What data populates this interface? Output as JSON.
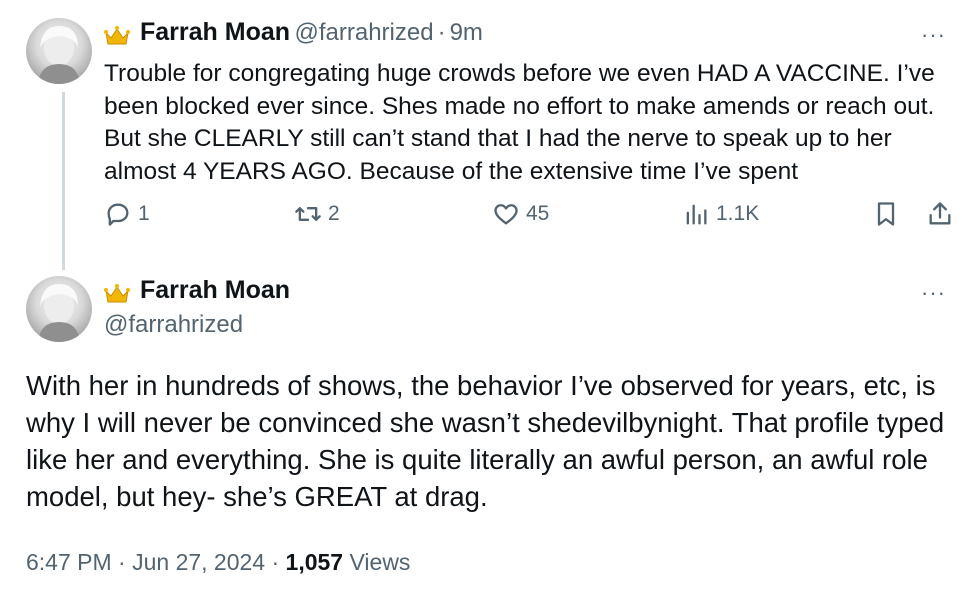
{
  "tweet1": {
    "display_name": "Farrah Moan",
    "handle": "@farrahrized",
    "separator": "·",
    "time": "9m",
    "more": "···",
    "text": "Trouble for congregating huge crowds before we even HAD A VACCINE. I’ve been blocked ever since. Shes made no effort to make amends or reach out. But she CLEARLY still can’t stand that I had the nerve to speak up to her almost 4 YEARS AGO. Because of the extensive time I’ve spent",
    "actions": {
      "replies": "1",
      "reposts": "2",
      "likes": "45",
      "views": "1.1K"
    }
  },
  "tweet2": {
    "display_name": "Farrah Moan",
    "handle": "@farrahrized",
    "more": "···",
    "text": "With her in hundreds of shows, the behavior I’ve observed for years, etc, is why I will never be convinced she wasn’t shedevilbynight. That profile typed like her and everything. She is quite literally an awful person, an awful role model, but hey- she’s GREAT at drag.",
    "timestamp": "6:47 PM · Jun 27, 2024 · ",
    "views_count": "1,057",
    "views_label": "Views"
  },
  "colors": {
    "text": "#0f1419",
    "secondary": "#536471",
    "thread_line": "#cfd9de",
    "crown": "#f2b705"
  },
  "icons": [
    "crown-icon",
    "reply-icon",
    "repost-icon",
    "like-icon",
    "views-icon",
    "bookmark-icon",
    "share-icon",
    "more-icon"
  ]
}
